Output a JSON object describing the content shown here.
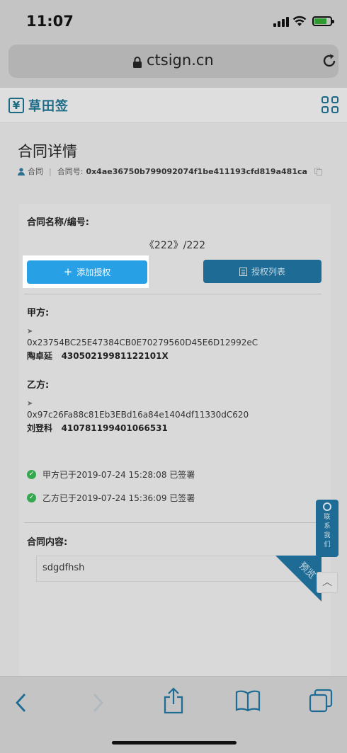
{
  "status_bar": {
    "time": "11:07"
  },
  "browser": {
    "url": "ctsign.cn"
  },
  "site": {
    "logo_text": "草田签"
  },
  "page": {
    "title": "合同详情",
    "owner_label": "合同",
    "contract_no_label": "合同号:",
    "contract_hash": "0x4ae36750b799092074f1be411193cfd819a481ca"
  },
  "card": {
    "name_label": "合同名称/编号:",
    "contract_name": "《222》/222",
    "add_auth_button": "添加授权",
    "auth_list_button": "授权列表",
    "party_a": {
      "label": "甲方:",
      "address": "0x23754BC25E47384CB0E70279560D45E6D12992eC",
      "name": "陶卓延",
      "id_number": "43050219981122101X"
    },
    "party_b": {
      "label": "乙方:",
      "address": "0x97c26Fa88c81Eb3EBd16a84e1404df11330dC620",
      "name": "刘登科",
      "id_number": "410781199401066531"
    },
    "signatures": [
      "甲方已于2019-07-24 15:28:08 已签署",
      "乙方已于2019-07-24 15:36:09 已签署"
    ],
    "content_label": "合同内容:",
    "content_text": "sdgdfhsh",
    "preview_label": "预览"
  },
  "floating": {
    "contact_label": "联系我们"
  },
  "colors": {
    "brand": "#1c6b86",
    "primary_button": "#27a0e6",
    "secondary_button": "#1e6c95",
    "success": "#35a84f"
  },
  "icons": [
    "signal-icon",
    "wifi-icon",
    "battery-icon",
    "lock-icon",
    "reload-icon",
    "grid-menu-icon",
    "user-icon",
    "copy-icon",
    "plus-icon",
    "list-icon",
    "check-icon",
    "back-icon",
    "forward-icon",
    "share-icon",
    "bookmarks-icon",
    "tabs-icon"
  ]
}
